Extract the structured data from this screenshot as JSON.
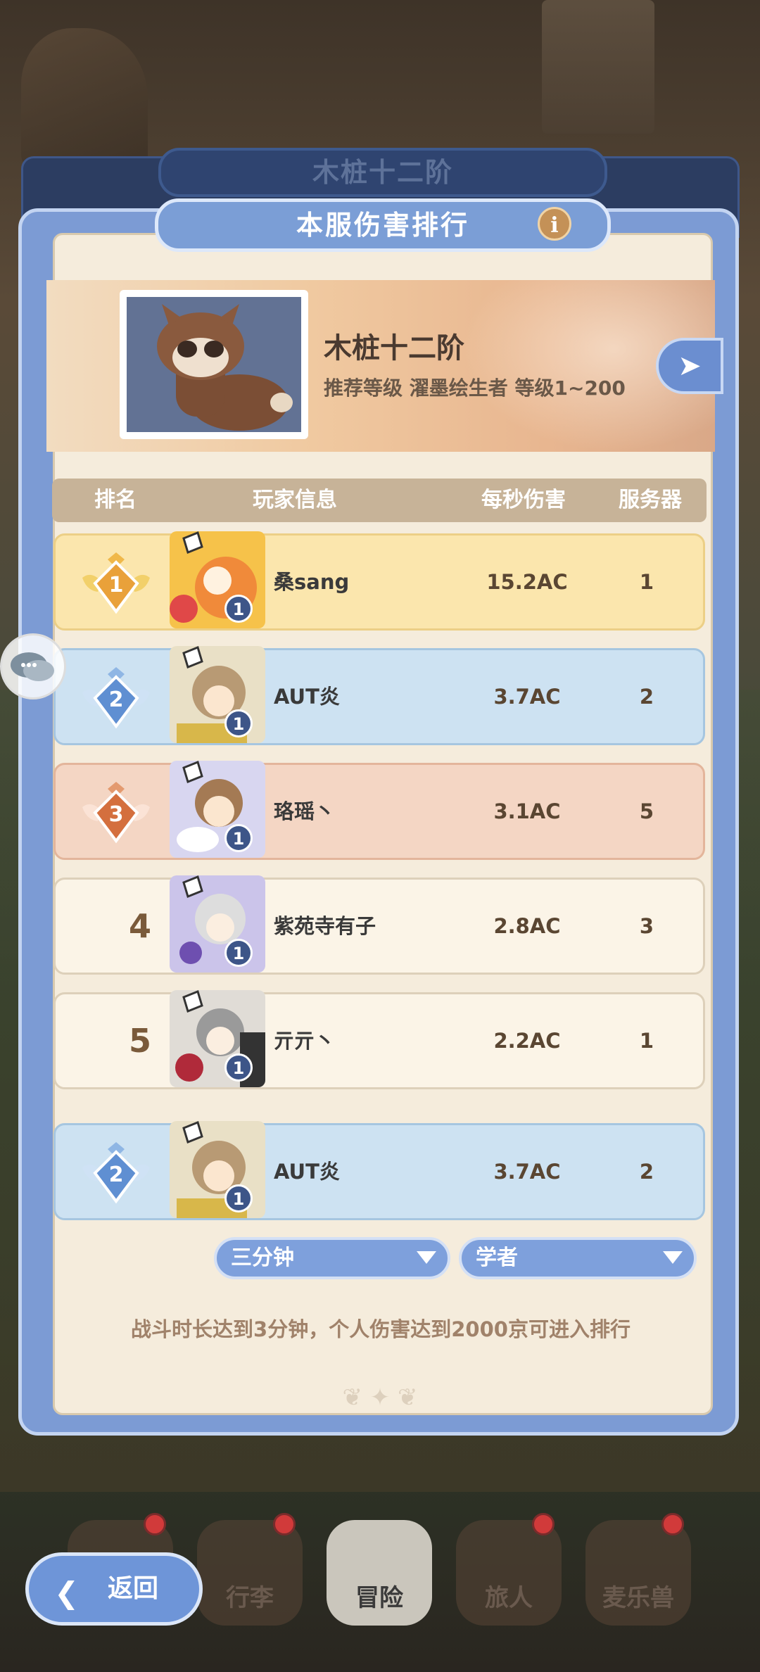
{
  "back_tab": {
    "title": "木桩十二阶"
  },
  "panel": {
    "title": "本服伤害排行",
    "info_icon": "info-icon"
  },
  "boss": {
    "name": "木桩十二阶",
    "subtitle": "推荐等级 濯墨绘生者 等级1~200"
  },
  "table": {
    "headers": [
      "排名",
      "玩家信息",
      "每秒伤害",
      "服务器"
    ],
    "rows": [
      {
        "rank": "1",
        "name": "桑sang",
        "dps": "15.2AC",
        "server": "1",
        "level": "1"
      },
      {
        "rank": "2",
        "name": "AUT炎",
        "dps": "3.7AC",
        "server": "2",
        "level": "1"
      },
      {
        "rank": "3",
        "name": "珞瑶丶",
        "dps": "3.1AC",
        "server": "5",
        "level": "1"
      },
      {
        "rank": "4",
        "name": "紫苑寺有子",
        "dps": "2.8AC",
        "server": "3",
        "level": "1"
      },
      {
        "rank": "5",
        "name": "亓亓丶",
        "dps": "2.2AC",
        "server": "1",
        "level": "1"
      }
    ],
    "self_row": {
      "rank": "2",
      "name": "AUT炎",
      "dps": "3.7AC",
      "server": "2",
      "level": "1"
    }
  },
  "filters": {
    "duration": "三分钟",
    "class": "学者"
  },
  "note": "战斗时长达到3分钟，个人伤害达到2000京可进入排行",
  "nav": {
    "back": "返回",
    "items": [
      "行李",
      "冒险",
      "旅人",
      "麦乐兽"
    ],
    "active": "冒险"
  },
  "colors": {
    "panel_blue": "#7c9bd4",
    "gold": "#fbe6ad",
    "blue_row": "#cde2f2",
    "pink_row": "#f4d6c4"
  }
}
